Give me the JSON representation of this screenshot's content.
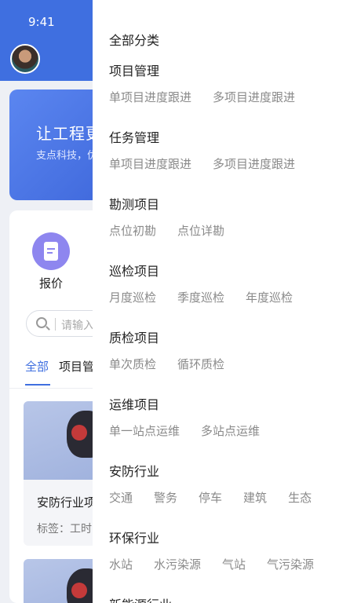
{
  "status_bar": {
    "time": "9:41"
  },
  "banner": {
    "title": "让工程更",
    "subtitle": "支点科技，优"
  },
  "quick_entry": {
    "label": "报价"
  },
  "search": {
    "placeholder": "请输入"
  },
  "tabs": [
    {
      "label": "全部",
      "active": true
    },
    {
      "label": "项目管"
    }
  ],
  "cards": [
    {
      "title": "安防行业项",
      "tags": "标签：工时"
    }
  ],
  "drawer": {
    "title": "全部分类",
    "groups": [
      {
        "name": "项目管理",
        "items": [
          "单项目进度跟进",
          "多项目进度跟进"
        ]
      },
      {
        "name": "任务管理",
        "items": [
          "单项目进度跟进",
          "多项目进度跟进"
        ]
      },
      {
        "name": "勘测项目",
        "items": [
          "点位初勘",
          "点位详勘"
        ]
      },
      {
        "name": "巡检项目",
        "items": [
          "月度巡检",
          "季度巡检",
          "年度巡检"
        ]
      },
      {
        "name": "质检项目",
        "items": [
          "单次质检",
          "循环质检"
        ]
      },
      {
        "name": "运维项目",
        "items": [
          "单一站点运维",
          "多站点运维"
        ]
      },
      {
        "name": "安防行业",
        "items": [
          "交通",
          "警务",
          "停车",
          "建筑",
          "生态"
        ]
      },
      {
        "name": "环保行业",
        "items": [
          "水站",
          "水污染源",
          "气站",
          "气污染源"
        ]
      },
      {
        "name": "新能源行业",
        "items": []
      }
    ]
  },
  "colors": {
    "brand_blue": "#3f6fe0",
    "quote_icon": "#8e86ef"
  }
}
